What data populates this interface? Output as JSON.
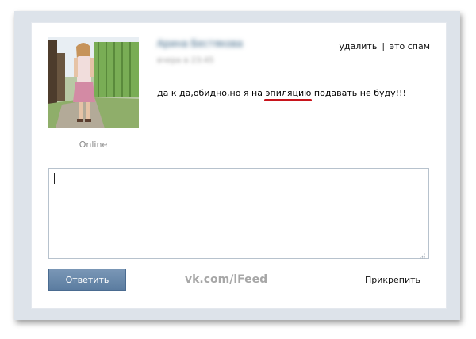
{
  "post": {
    "author_name": "Арина Бестякова",
    "date": "вчера в 23:45",
    "status": "Online",
    "message_before": "да к да,обидно,но я на ",
    "message_highlight": "эпиляцию",
    "message_after": " подавать не буду!!!",
    "highlight_color": "#c8141c"
  },
  "actions": {
    "delete_label": "удалить",
    "separator": "|",
    "spam_label": "это спам"
  },
  "reply": {
    "value": "",
    "submit_label": "Ответить",
    "attach_label": "Прикрепить"
  },
  "watermark": "vk.com/iFeed",
  "icons": {
    "resize": "resize-grip-icon"
  }
}
